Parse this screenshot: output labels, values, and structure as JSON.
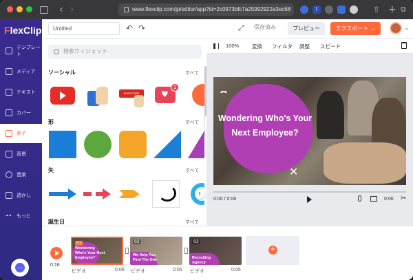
{
  "browser": {
    "url": "www.flexclip.com/jp/editor/app?id=2c0973bfc7a25992922a3ec68",
    "back_glyph": "‹",
    "forward_glyph": "›",
    "share_glyph": "⇧",
    "newtab_glyph": "+",
    "tabs_glyph": "⧉",
    "ext_badge": "1",
    "traffic_colors": [
      "#ff5f57",
      "#febc2e",
      "#28c840"
    ]
  },
  "sidebar": {
    "logo_f": "F",
    "logo_rest": "lexClip",
    "items": [
      {
        "label": "テンプレート",
        "icon": "layers-icon"
      },
      {
        "label": "メディア",
        "icon": "folder-icon"
      },
      {
        "label": "テキスト",
        "icon": "text-icon"
      },
      {
        "label": "カバー",
        "icon": "cover-icon"
      },
      {
        "label": "素子",
        "icon": "elements-icon",
        "active": true
      },
      {
        "label": "背景",
        "icon": "background-icon"
      },
      {
        "label": "音楽",
        "icon": "music-icon"
      },
      {
        "label": "透かし",
        "icon": "watermark-icon"
      },
      {
        "label": "もっと",
        "icon": "more-icon"
      }
    ],
    "chat_glyph": "…"
  },
  "topbar": {
    "title_value": "Untitled",
    "undo_glyph": "↶",
    "redo_glyph": "↷",
    "fullscreen_glyph": "⤢",
    "saved_label": "保存済み",
    "preview_label": "プレビュー",
    "export_label": "エクスポート →",
    "avatar_caret": "⌄"
  },
  "panel": {
    "search_placeholder": "検索ウィジェット",
    "categories": [
      {
        "name": "ソーシャル",
        "all": "すべて"
      },
      {
        "name": "形",
        "all": "すべて"
      },
      {
        "name": "矢",
        "all": "すべて"
      },
      {
        "name": "誕生日",
        "all": "すべて"
      }
    ],
    "social_subscribe_text": "SUBSCRIBE",
    "notification_count": "1",
    "scroll_arrow": "›",
    "collapse_arrow": "‹"
  },
  "preview": {
    "zoom": "100%",
    "menu": [
      "変換",
      "フィルタ",
      "調整",
      "スピード"
    ],
    "video_text": "Wondering Who's Your Next Employee?",
    "time": "0:00 / 0:06",
    "duration": "0:06",
    "colors": {
      "blob": "#b13fb4",
      "accent": "#ff6a3c"
    }
  },
  "timeline": {
    "total_time": "0:16",
    "clips": [
      {
        "num": "01",
        "text": "Wondering Who's Your Next Employee?",
        "label": "ビデオ",
        "duration": "0:06"
      },
      {
        "num": "02",
        "text": "We Help You Find The One",
        "label": "ビデオ",
        "duration": "0:05"
      },
      {
        "num": "03",
        "text": "Recruiting Agency",
        "label": "ビデオ",
        "duration": "0:05"
      }
    ],
    "add_glyph": "+"
  }
}
